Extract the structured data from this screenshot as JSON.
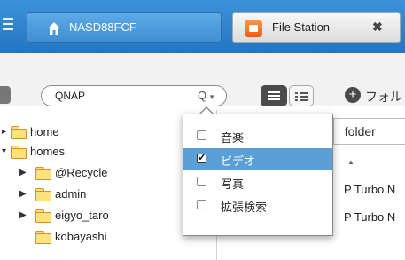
{
  "topbar": {
    "nas_tab_label": "NASD88FCF",
    "app_tab_label": "File Station",
    "close_glyph": "✖"
  },
  "toolbar": {
    "search_value": "QNAP",
    "search_icon": "Q",
    "add_folder_label": "フォル",
    "add_folder_icon": "plus-circle"
  },
  "tree": {
    "items": [
      {
        "label": "home"
      },
      {
        "label": "homes"
      },
      {
        "label": "@Recycle"
      },
      {
        "label": "admin"
      },
      {
        "label": "eigyo_taro"
      },
      {
        "label": "kobayashi"
      }
    ]
  },
  "right_pane": {
    "path_value": "_folder",
    "rows": [
      "P Turbo N",
      "P Turbo N"
    ]
  },
  "dropdown": {
    "items": [
      {
        "label": "音楽",
        "checked": false
      },
      {
        "label": "ビデオ",
        "checked": true
      },
      {
        "label": "写真",
        "checked": false
      },
      {
        "label": "拡張検索",
        "checked": false
      }
    ],
    "highlight_color": "#5a9fd6"
  },
  "colors": {
    "topbar": "#2f84cf",
    "file_station_icon": "#f07a2a"
  }
}
